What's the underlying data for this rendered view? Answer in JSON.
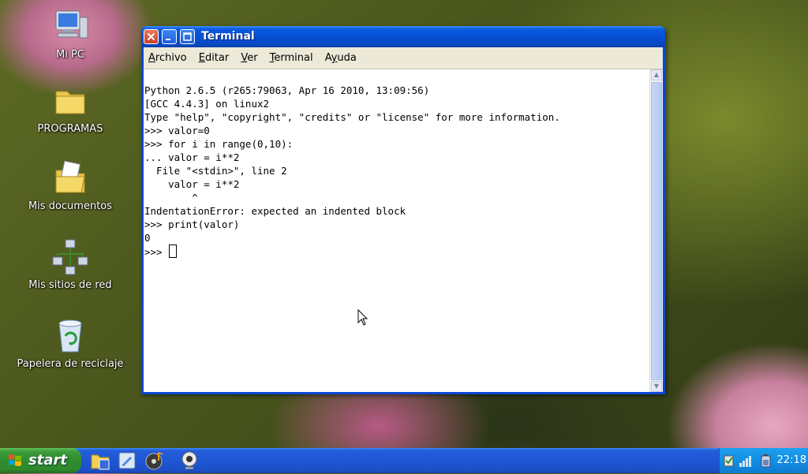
{
  "desktop": {
    "icons": [
      {
        "label": "Mi PC",
        "icon": "computer-icon"
      },
      {
        "label": "PROGRAMAS",
        "icon": "folder-icon"
      },
      {
        "label": "Mis documentos",
        "icon": "documents-folder-icon"
      },
      {
        "label": "Mis sitios de red",
        "icon": "network-icon"
      },
      {
        "label": "Papelera de reciclaje",
        "icon": "recycle-bin-icon"
      }
    ]
  },
  "window": {
    "title": "Terminal",
    "menu": [
      {
        "accel": "A",
        "rest": "rchivo"
      },
      {
        "accel": "E",
        "rest": "ditar"
      },
      {
        "accel": "V",
        "rest": "er"
      },
      {
        "accel": "T",
        "rest": "erminal"
      },
      {
        "accel": "y",
        "pre": "A",
        "rest": "uda"
      }
    ],
    "lines": [
      "Python 2.6.5 (r265:79063, Apr 16 2010, 13:09:56)",
      "[GCC 4.4.3] on linux2",
      "Type \"help\", \"copyright\", \"credits\" or \"license\" for more information.",
      ">>> valor=0",
      ">>> for i in range(0,10):",
      "... valor = i**2",
      "  File \"<stdin>\", line 2",
      "    valor = i**2",
      "        ^",
      "IndentationError: expected an indented block",
      ">>> print(valor)",
      "0"
    ],
    "prompt": ">>> "
  },
  "taskbar": {
    "start_label": "start",
    "clock": "22:18"
  },
  "colors": {
    "taskbar_blue": "#245dda",
    "start_green": "#3c9b3a",
    "title_blue": "#0551d6",
    "menu_bg": "#ece9d8"
  }
}
